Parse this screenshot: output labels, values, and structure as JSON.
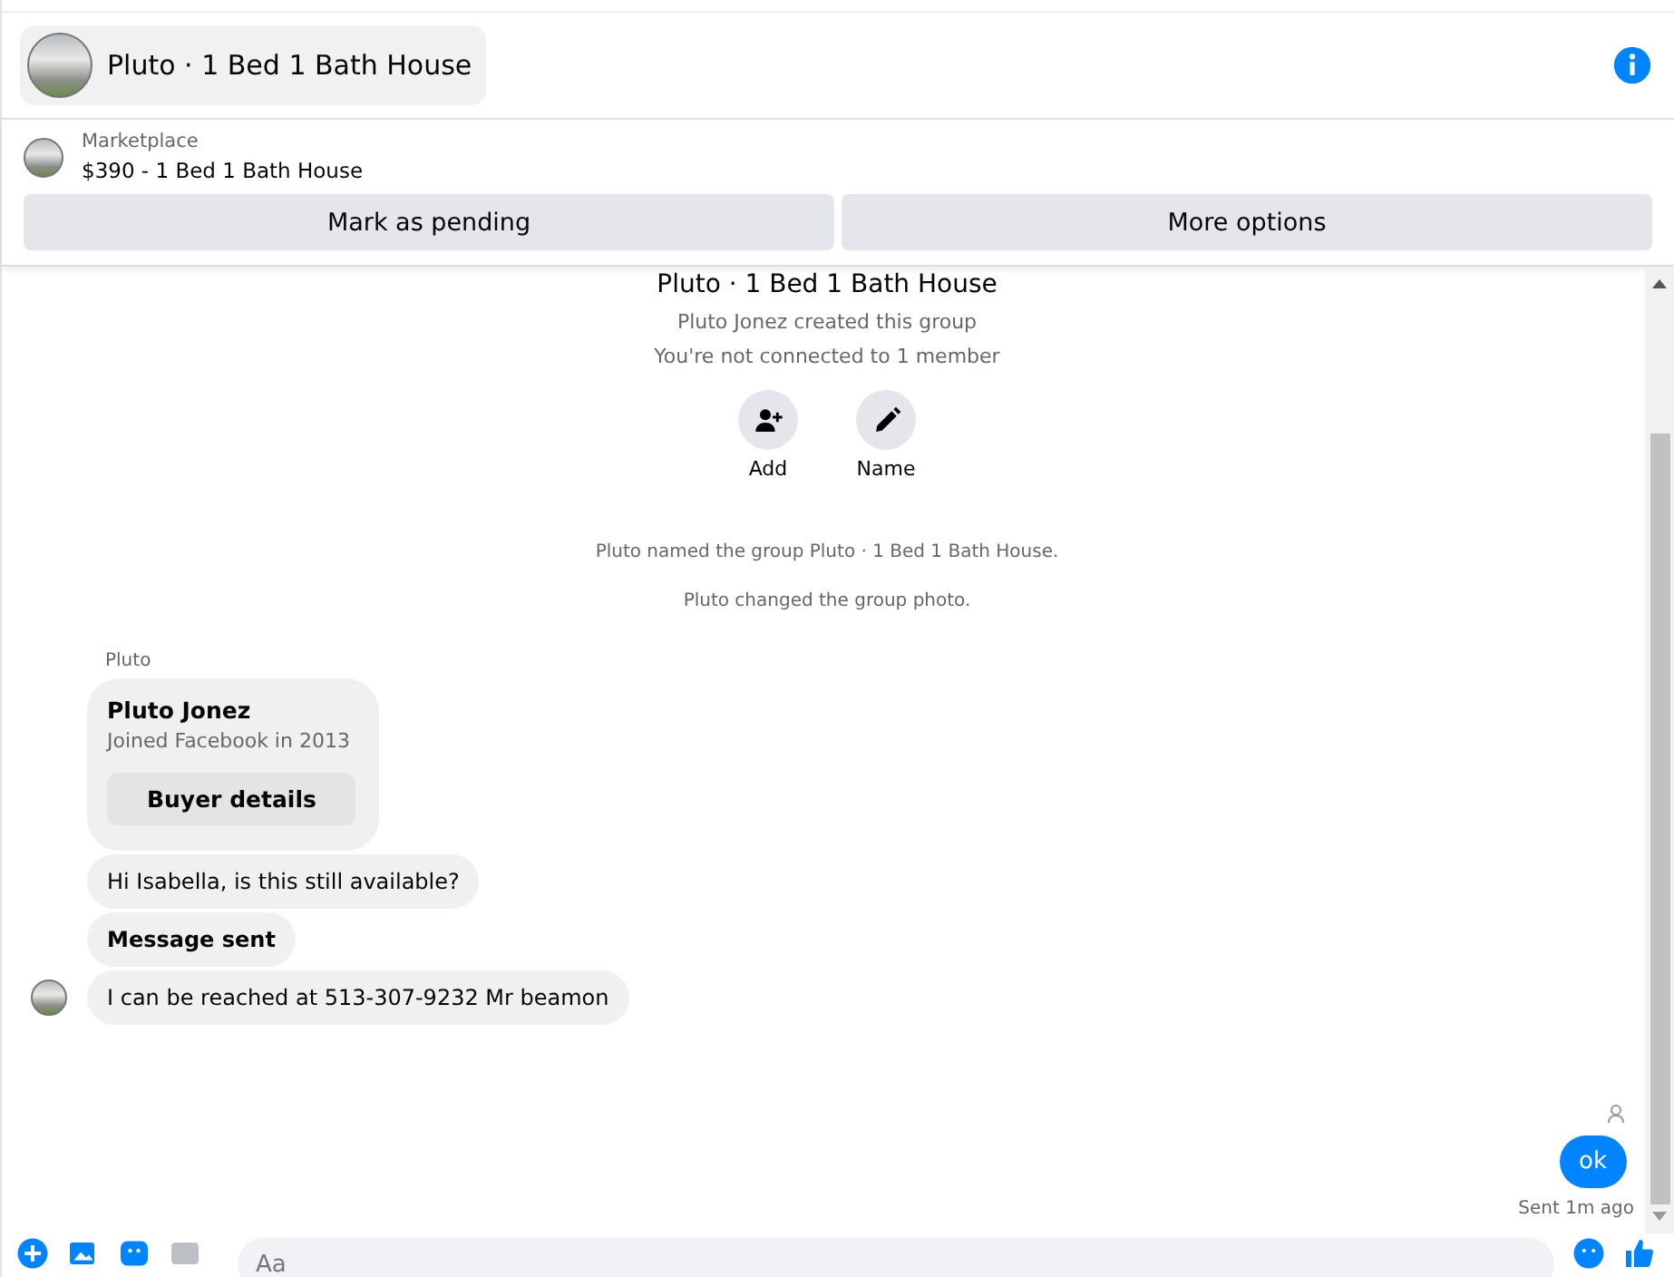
{
  "header": {
    "title": "Pluto · 1 Bed 1 Bath House"
  },
  "listing": {
    "source": "Marketplace",
    "summary": "$390 - 1 Bed 1 Bath House",
    "buttons": [
      "Mark as pending",
      "More options"
    ]
  },
  "intro": {
    "title": "Pluto · 1 Bed 1 Bath House",
    "lines": [
      "Pluto Jonez created this group",
      "You're not connected to 1 member"
    ],
    "actions": [
      {
        "kind": "add",
        "label": "Add"
      },
      {
        "kind": "name",
        "label": "Name"
      }
    ]
  },
  "events": [
    "Pluto named the group Pluto · 1 Bed 1 Bath House.",
    "Pluto changed the group photo."
  ],
  "sender": "Pluto",
  "messages": [
    {
      "kind": "card",
      "title": "Pluto Jonez",
      "subtitle": "Joined Facebook in 2013",
      "button": "Buyer details",
      "show_avatar": false
    },
    {
      "kind": "text",
      "text": "Hi Isabella, is this still available?",
      "show_avatar": false
    },
    {
      "kind": "bold",
      "text": "Message sent",
      "show_avatar": false
    },
    {
      "kind": "text",
      "text": "I can be reached at 513-307-9232 Mr beamon",
      "show_avatar": true
    }
  ],
  "outgoing": {
    "text": "ok",
    "status": "Sent 1m ago"
  },
  "composer": {
    "placeholder": "Aa"
  }
}
